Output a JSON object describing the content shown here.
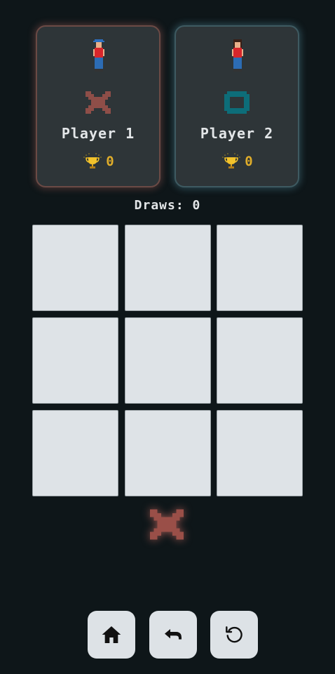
{
  "players": [
    {
      "name": "Player 1",
      "mark": "X",
      "mark_color": "#8e4e48",
      "glow_color": "#c07065",
      "score": "0"
    },
    {
      "name": "Player 2",
      "mark": "O",
      "mark_color": "#0d6d79",
      "glow_color": "#6aaec0",
      "score": "0"
    }
  ],
  "draws_text": "Draws: 0",
  "board": {
    "cells": [
      "",
      "",
      "",
      "",
      "",
      "",
      "",
      "",
      ""
    ]
  },
  "turn_indicator": {
    "mark": "X",
    "color": "#9a4f48"
  },
  "controls": {
    "home_icon": "home-icon",
    "undo_icon": "undo-icon",
    "restart_icon": "restart-icon"
  },
  "colors": {
    "background": "#0e1619",
    "card": "#2e3538",
    "cell": "#dee3e7",
    "score": "#e0ad2a"
  }
}
